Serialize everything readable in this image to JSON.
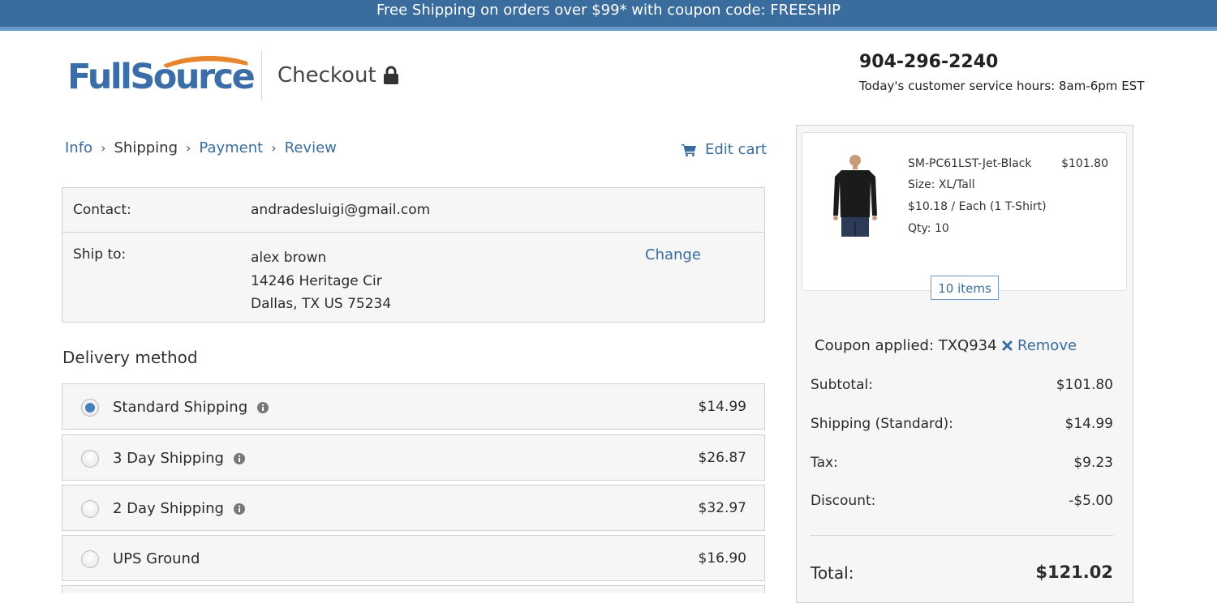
{
  "promo": {
    "text": "Free Shipping on orders over $99* with coupon code: FREESHIP"
  },
  "header": {
    "logo_text": "FullSource",
    "title": "Checkout",
    "phone": "904-296-2240",
    "hours": "Today's customer service hours: 8am-6pm EST"
  },
  "breadcrumb": {
    "items": [
      {
        "label": "Info"
      },
      {
        "label": "Shipping"
      },
      {
        "label": "Payment"
      },
      {
        "label": "Review"
      }
    ],
    "edit_cart": "Edit cart"
  },
  "info": {
    "contact_label": "Contact:",
    "contact_value": "andradesluigi@gmail.com",
    "shipto_label": "Ship to:",
    "shipto_name": "alex brown",
    "shipto_street": "14246 Heritage Cir",
    "shipto_city": "Dallas, TX US 75234",
    "change": "Change"
  },
  "delivery": {
    "heading": "Delivery method",
    "options": [
      {
        "label": "Standard Shipping",
        "price": "$14.99",
        "selected": true
      },
      {
        "label": "3 Day Shipping",
        "price": "$26.87",
        "selected": false
      },
      {
        "label": "2 Day Shipping",
        "price": "$32.97",
        "selected": false
      },
      {
        "label": "UPS Ground",
        "price": "$16.90",
        "selected": false
      }
    ]
  },
  "summary": {
    "product": {
      "name": "SM-PC61LST-Jet-Black",
      "price": "$101.80",
      "size": "Size: XL/Tall",
      "each": "$10.18 / Each (1 T-Shirt)",
      "qty": "Qty: 10"
    },
    "items_badge": "10 items",
    "coupon": "Coupon applied: TXQ934",
    "remove": "Remove",
    "rows": [
      {
        "label": "Subtotal:",
        "value": "$101.80"
      },
      {
        "label": "Shipping (Standard):",
        "value": "$14.99"
      },
      {
        "label": "Tax:",
        "value": "$9.23"
      },
      {
        "label": "Discount:",
        "value": "-$5.00"
      }
    ],
    "total_label": "Total:",
    "total_value": "$121.02"
  },
  "colors": {
    "accent": "#3a6c9e",
    "promo_bg": "#3a6c9e",
    "logo_orange": "#e8862e"
  },
  "icons": [
    "lock-icon",
    "cart-icon",
    "info-icon",
    "close-icon"
  ]
}
